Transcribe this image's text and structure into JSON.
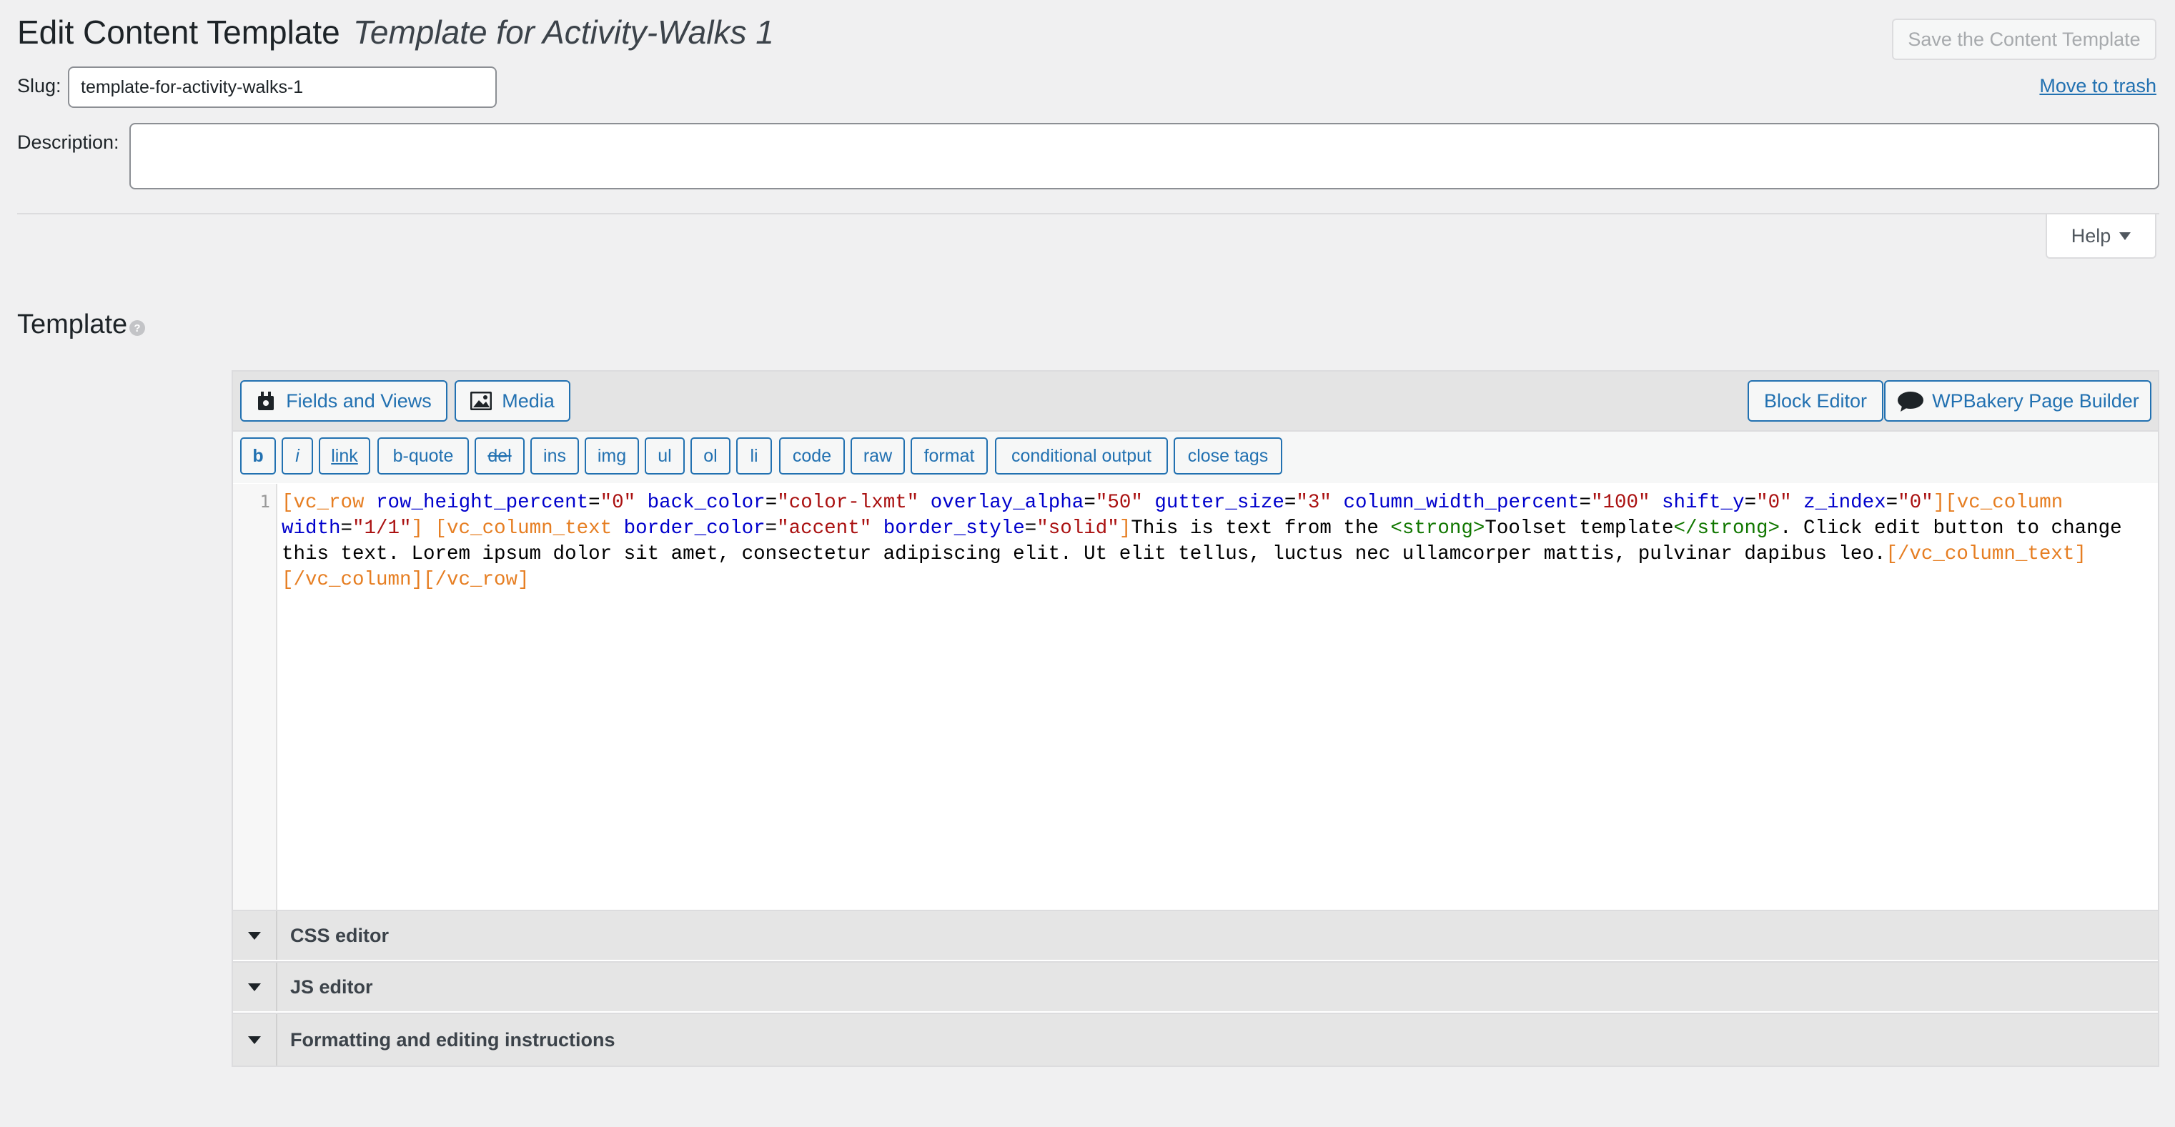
{
  "header": {
    "title": "Edit Content Template",
    "subtitle": "Template for Activity-Walks 1",
    "save_label": "Save the Content Template",
    "trash_label": "Move to trash"
  },
  "slug": {
    "label": "Slug:",
    "value": "template-for-activity-walks-1"
  },
  "description": {
    "label": "Description:",
    "value": ""
  },
  "help": {
    "label": "Help"
  },
  "template": {
    "title": "Template",
    "toolbar": {
      "fields_views": "Fields and Views",
      "media": "Media",
      "block_editor": "Block Editor",
      "wpbakery": "WPBakery Page Builder"
    },
    "quicktags": [
      "b",
      "i",
      "link",
      "b-quote",
      "del",
      "ins",
      "img",
      "ul",
      "ol",
      "li",
      "code",
      "raw",
      "format",
      "conditional output",
      "close tags"
    ],
    "code": {
      "line_number": "1",
      "segments": [
        {
          "t": "[vc_row",
          "c": "c-tag"
        },
        {
          "t": " ",
          "c": ""
        },
        {
          "t": "row_height_percent",
          "c": "c-attr"
        },
        {
          "t": "=",
          "c": ""
        },
        {
          "t": "\"0\"",
          "c": "c-str"
        },
        {
          "t": " ",
          "c": ""
        },
        {
          "t": "back_color",
          "c": "c-attr"
        },
        {
          "t": "=",
          "c": ""
        },
        {
          "t": "\"color-lxmt\"",
          "c": "c-str"
        },
        {
          "t": " ",
          "c": ""
        },
        {
          "t": "overlay_alpha",
          "c": "c-attr"
        },
        {
          "t": "=",
          "c": ""
        },
        {
          "t": "\"50\"",
          "c": "c-str"
        },
        {
          "t": " ",
          "c": ""
        },
        {
          "t": "gutter_size",
          "c": "c-attr"
        },
        {
          "t": "=",
          "c": ""
        },
        {
          "t": "\"3\"",
          "c": "c-str"
        },
        {
          "t": " ",
          "c": ""
        },
        {
          "t": "column_width_percent",
          "c": "c-attr"
        },
        {
          "t": "=",
          "c": ""
        },
        {
          "t": "\"100\"",
          "c": "c-str"
        },
        {
          "t": " ",
          "c": ""
        },
        {
          "t": "shift_y",
          "c": "c-attr"
        },
        {
          "t": "=",
          "c": ""
        },
        {
          "t": "\"0\"",
          "c": "c-str"
        },
        {
          "t": " ",
          "c": ""
        },
        {
          "t": "z_index",
          "c": "c-attr"
        },
        {
          "t": "=",
          "c": ""
        },
        {
          "t": "\"0\"",
          "c": "c-str"
        },
        {
          "t": "][vc_column",
          "c": "c-tag"
        },
        {
          "t": " ",
          "c": ""
        },
        {
          "t": "width",
          "c": "c-attr"
        },
        {
          "t": "=",
          "c": ""
        },
        {
          "t": "\"1/1\"",
          "c": "c-str"
        },
        {
          "t": "] [vc_column_text",
          "c": "c-tag"
        },
        {
          "t": " ",
          "c": ""
        },
        {
          "t": "border_color",
          "c": "c-attr"
        },
        {
          "t": "=",
          "c": ""
        },
        {
          "t": "\"accent\"",
          "c": "c-str"
        },
        {
          "t": " ",
          "c": ""
        },
        {
          "t": "border_style",
          "c": "c-attr"
        },
        {
          "t": "=",
          "c": ""
        },
        {
          "t": "\"solid\"",
          "c": "c-str"
        },
        {
          "t": "]",
          "c": "c-tag"
        },
        {
          "t": "This is text from the ",
          "c": ""
        },
        {
          "t": "<strong>",
          "c": "c-html"
        },
        {
          "t": "Toolset template",
          "c": ""
        },
        {
          "t": "</strong>",
          "c": "c-html"
        },
        {
          "t": ". Click edit button to change this text. Lorem ipsum dolor sit amet, consectetur adipiscing elit. Ut elit tellus, luctus nec ullamcorper mattis, pulvinar dapibus leo.",
          "c": ""
        },
        {
          "t": "[/vc_column_text][/vc_column][/vc_row]",
          "c": "c-tag"
        }
      ]
    },
    "accordions": [
      "CSS editor",
      "JS editor",
      "Formatting and editing instructions"
    ]
  },
  "colors": {
    "link": "#2271b1",
    "background": "#f0f0f1"
  },
  "icons": {
    "fields_views": "plugin-icon",
    "media": "media-image-icon",
    "wpbakery": "wpbakery-logo-icon",
    "help": "caret-down-icon"
  }
}
